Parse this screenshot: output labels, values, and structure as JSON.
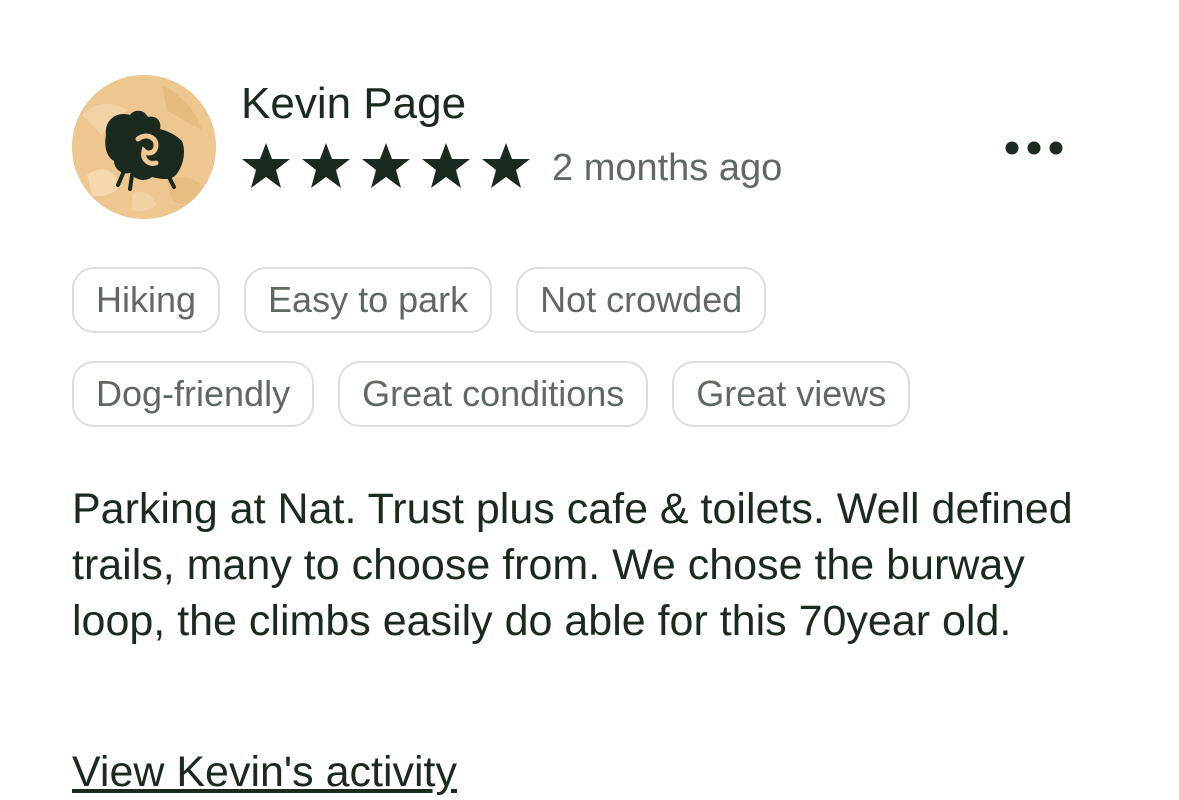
{
  "review": {
    "author": "Kevin Page",
    "rating": 5,
    "rating_max": 5,
    "date": "2 months ago",
    "tags": {
      "row1": [
        "Hiking",
        "Easy to park",
        "Not crowded"
      ],
      "row2": [
        "Dog-friendly",
        "Great conditions",
        "Great views"
      ]
    },
    "text": "Parking at Nat. Trust plus cafe & toilets. Well defined trails, many to choose from. We chose the burway loop, the climbs easily do able for this 70year old.",
    "view_activity_link": "View Kevin's activity"
  },
  "icons": {
    "avatar": "avatar-icon",
    "star": "star-icon",
    "more": "more-options-icon"
  },
  "colors": {
    "text_primary": "#1b2a1f",
    "text_secondary": "#5f6861",
    "chip_border": "#dcdedb",
    "avatar_bg": "#edc690",
    "star": "#1b2a1f"
  }
}
